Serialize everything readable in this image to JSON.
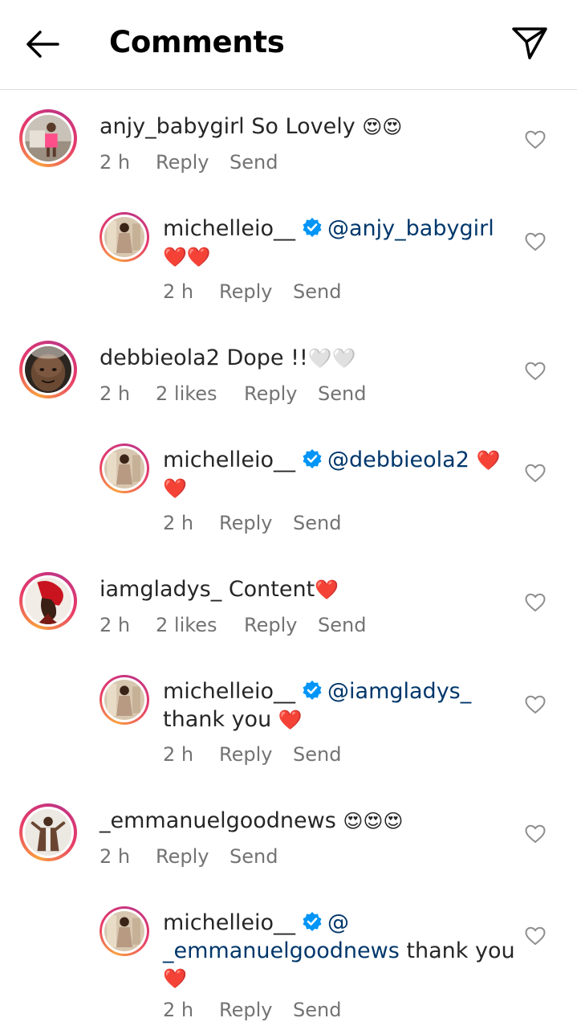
{
  "header": {
    "title": "Comments"
  },
  "comments": [
    {
      "username": "anjy_babygirl",
      "text": "So Lovely",
      "emoji": "😍😍",
      "time": "2 h",
      "reply": "Reply",
      "send": "Send",
      "reply_item": {
        "username": "michelleio__",
        "mention": "@anjy_babygirl",
        "line2": "",
        "emoji2": "❤️❤️",
        "time": "2 h",
        "reply": "Reply",
        "send": "Send"
      }
    },
    {
      "username": "debbieola2",
      "text": "Dope !!",
      "emoji": "🤍🤍",
      "time": "2 h",
      "likes": "2 likes",
      "reply": "Reply",
      "send": "Send",
      "reply_item": {
        "username": "michelleio__",
        "mention": "@debbieola2",
        "emoji1": "❤️",
        "emoji2": "❤️",
        "time": "2 h",
        "reply": "Reply",
        "send": "Send"
      }
    },
    {
      "username": "iamgladys_",
      "text": "Content",
      "emoji": "❤️",
      "time": "2 h",
      "likes": "2 likes",
      "reply": "Reply",
      "send": "Send",
      "reply_item": {
        "username": "michelleio__",
        "mention": "@iamgladys_",
        "line2": "thank you",
        "emoji2": "❤️",
        "time": "2 h",
        "reply": "Reply",
        "send": "Send"
      }
    },
    {
      "username": "_emmanuelgoodnews",
      "text": "",
      "emoji": "😍😍😍",
      "time": "2 h",
      "reply": "Reply",
      "send": "Send",
      "reply_item": {
        "username": "michelleio__",
        "mention": "@",
        "mention2": "_emmanuelgoodnews",
        "line2": "thank you",
        "emoji3": "❤️",
        "time": "2 h",
        "reply": "Reply",
        "send": "Send"
      }
    }
  ]
}
